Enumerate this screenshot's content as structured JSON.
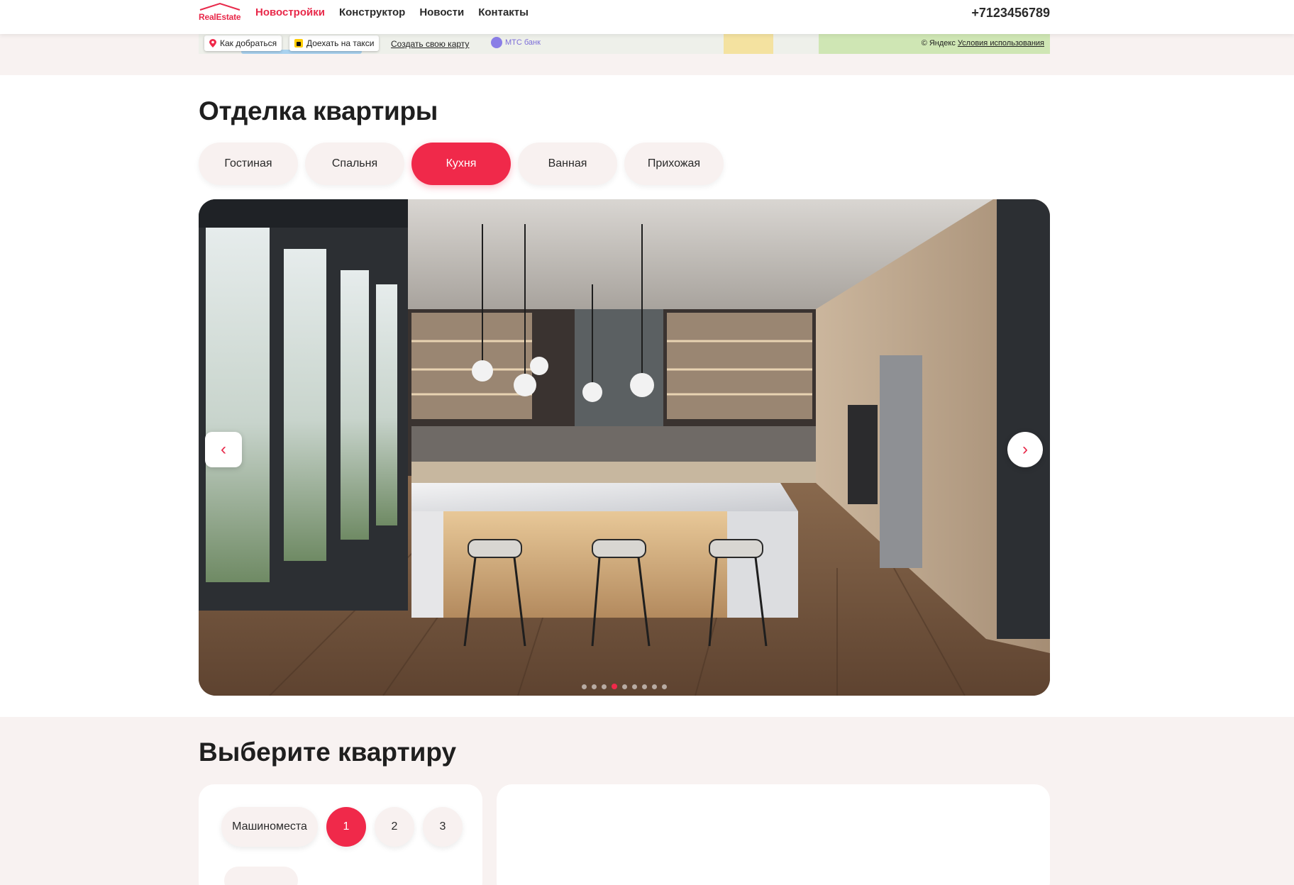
{
  "header": {
    "logo": "RealEstate",
    "nav": [
      "Новостройки",
      "Конструктор",
      "Новости",
      "Контакты"
    ],
    "phone": "+7123456789"
  },
  "map": {
    "route_label": "Как добраться",
    "taxi_label": "Доехать на такси",
    "create_map_link": "Создать свою карту",
    "poi_label": "МТС банк",
    "copyright": "© Яндекс",
    "terms_link": "Условия использования"
  },
  "finishing": {
    "title": "Отделка квартиры",
    "tabs": [
      {
        "label": "Гостиная",
        "active": false
      },
      {
        "label": "Спальня",
        "active": false
      },
      {
        "label": "Кухня",
        "active": true
      },
      {
        "label": "Ванная",
        "active": false
      },
      {
        "label": "Прихожая",
        "active": false
      }
    ],
    "slider": {
      "image_icon": "kitchen-interior-photo",
      "slide_count": 9,
      "active_slide": 4,
      "prev_icon": "chevron-left-icon",
      "next_icon": "chevron-right-icon"
    }
  },
  "choose": {
    "title": "Выберите квартиру",
    "room_filters": [
      {
        "label": "Машиноместа",
        "active": false
      },
      {
        "label": "1",
        "active": true
      },
      {
        "label": "2",
        "active": false
      },
      {
        "label": "3",
        "active": false
      }
    ]
  },
  "colors": {
    "accent": "#f0294a",
    "background_tint": "#f8f2f1",
    "text": "#1f1f1f"
  }
}
